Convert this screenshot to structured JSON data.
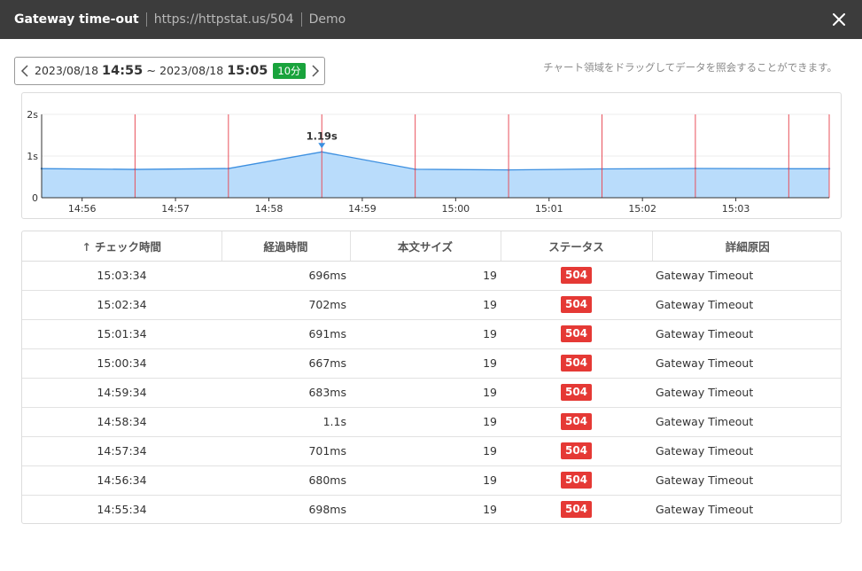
{
  "window": {
    "title": "Gateway time-out",
    "url": "https://httpstat.us/504",
    "project": "Demo"
  },
  "range": {
    "start_date": "2023/08/18",
    "start_hh": "14",
    "start_mm": "55",
    "separator": "~",
    "end_date": "2023/08/18",
    "end_hh": "15",
    "end_mm": "05",
    "duration_label": "10分"
  },
  "hint_text": "チャート領域をドラッグしてデータを照会することができます。",
  "colors": {
    "titlebar_bg": "#3c3c3c",
    "area_fill": "#b9dcfb",
    "line": "#3c8fe0",
    "marker_line": "#e8505b",
    "status_red": "#e53935",
    "badge_green": "#19a33c"
  },
  "chart_data": {
    "type": "area",
    "x": [
      "14:55:34",
      "14:56:34",
      "14:57:34",
      "14:58:34",
      "14:59:34",
      "15:00:34",
      "15:01:34",
      "15:02:34",
      "15:03:34",
      "15:04:00"
    ],
    "values": [
      0.698,
      0.68,
      0.701,
      1.1,
      0.683,
      0.667,
      0.691,
      0.702,
      0.696,
      0.696
    ],
    "x_ticks": [
      "14:56",
      "14:57",
      "14:58",
      "14:59",
      "15:00",
      "15:01",
      "15:02",
      "15:03"
    ],
    "y_ticks": [
      "0",
      "1s",
      "2s"
    ],
    "ylim": [
      0,
      2
    ],
    "annotation": {
      "label": "1.19s",
      "index": 3
    },
    "grid": true
  },
  "table": {
    "headers": {
      "check_time": "チェック時間",
      "elapsed": "経過時間",
      "body_size": "本文サイズ",
      "status": "ステータス",
      "reason": "詳細原因"
    },
    "rows": [
      {
        "time": "15:03:34",
        "elapsed": "696ms",
        "size": "19",
        "status": "504",
        "reason": "Gateway Timeout"
      },
      {
        "time": "15:02:34",
        "elapsed": "702ms",
        "size": "19",
        "status": "504",
        "reason": "Gateway Timeout"
      },
      {
        "time": "15:01:34",
        "elapsed": "691ms",
        "size": "19",
        "status": "504",
        "reason": "Gateway Timeout"
      },
      {
        "time": "15:00:34",
        "elapsed": "667ms",
        "size": "19",
        "status": "504",
        "reason": "Gateway Timeout"
      },
      {
        "time": "14:59:34",
        "elapsed": "683ms",
        "size": "19",
        "status": "504",
        "reason": "Gateway Timeout"
      },
      {
        "time": "14:58:34",
        "elapsed": "1.1s",
        "size": "19",
        "status": "504",
        "reason": "Gateway Timeout"
      },
      {
        "time": "14:57:34",
        "elapsed": "701ms",
        "size": "19",
        "status": "504",
        "reason": "Gateway Timeout"
      },
      {
        "time": "14:56:34",
        "elapsed": "680ms",
        "size": "19",
        "status": "504",
        "reason": "Gateway Timeout"
      },
      {
        "time": "14:55:34",
        "elapsed": "698ms",
        "size": "19",
        "status": "504",
        "reason": "Gateway Timeout"
      }
    ]
  }
}
